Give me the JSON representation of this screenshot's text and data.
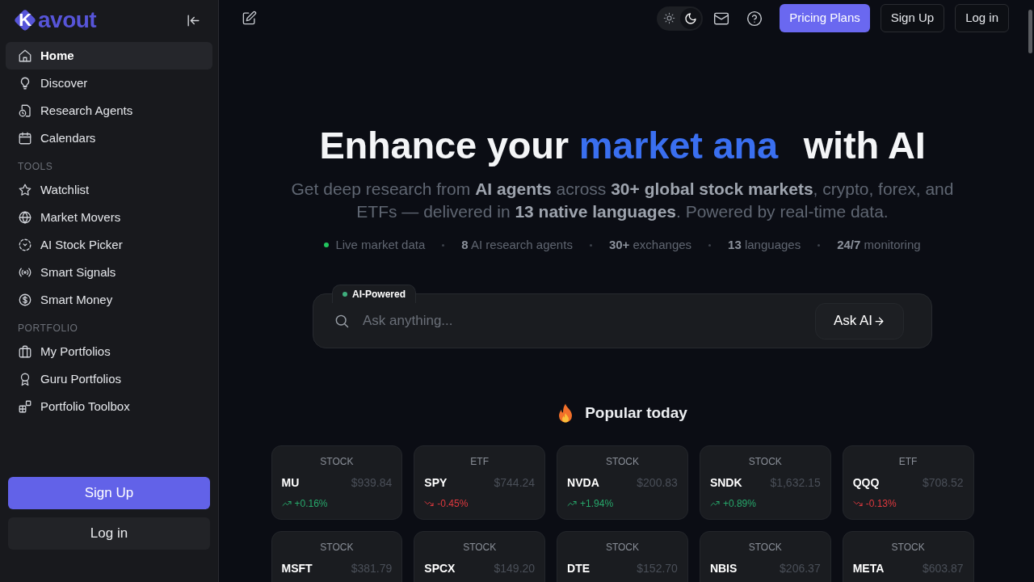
{
  "sidebar": {
    "logo": {
      "mark": "K",
      "text": "avout"
    },
    "sections": [
      {
        "items": [
          {
            "label": "Home",
            "selected": true
          },
          {
            "label": "Discover",
            "selected": false
          },
          {
            "label": "Research Agents",
            "selected": false
          },
          {
            "label": "Calendars",
            "selected": false
          }
        ]
      },
      {
        "title": "TOOLS",
        "items": [
          {
            "label": "Watchlist",
            "selected": false
          },
          {
            "label": "Market Movers",
            "selected": false
          },
          {
            "label": "AI Stock Picker",
            "selected": false
          },
          {
            "label": "Smart Signals",
            "selected": false
          },
          {
            "label": "Smart Money",
            "selected": false
          }
        ]
      },
      {
        "title": "PORTFOLIO",
        "items": [
          {
            "label": "My Portfolios",
            "selected": false
          },
          {
            "label": "Guru Portfolios",
            "selected": false
          },
          {
            "label": "Portfolio Toolbox",
            "selected": false
          }
        ]
      }
    ],
    "buttons": [
      {
        "label": "Sign Up",
        "kind": "primary"
      },
      {
        "label": "Log in",
        "kind": "secondary"
      }
    ]
  },
  "top_bar": {
    "theme_toggle": [
      {
        "kind": "light",
        "selected": false
      },
      {
        "kind": "dark",
        "selected": true
      }
    ],
    "buttons": [
      {
        "label": "Pricing Plans",
        "kind": "primary"
      },
      {
        "label": "Sign Up",
        "kind": "outline"
      },
      {
        "label": "Log in",
        "kind": "outline"
      }
    ]
  },
  "hero": {
    "heading": {
      "before": "Enhance your",
      "highlight": "market ana",
      "after": "with AI"
    },
    "subtitle": "Get deep research from **AI agents** across **30+ global stock markets**, crypto, forex, and ETFs — delivered in **13 native languages**. Powered by real-time data.",
    "stats": [
      {
        "kind": "live",
        "text": "Live market data"
      },
      {
        "kind": "stat",
        "text": "**8** AI research agents"
      },
      {
        "kind": "stat",
        "text": "**30+** exchanges"
      },
      {
        "kind": "stat",
        "text": "**13** languages"
      },
      {
        "kind": "stat",
        "text": "**24/7** monitoring"
      }
    ]
  },
  "search": {
    "badge": "AI-Powered",
    "placeholder": "Ask anything...",
    "button": "Ask AI"
  },
  "popular": {
    "title": "Popular today",
    "cards": [
      {
        "type": "STOCK",
        "ticker": "MU",
        "price": "$939.84",
        "change": "+0.16%",
        "rising": true
      },
      {
        "type": "ETF",
        "ticker": "SPY",
        "price": "$744.24",
        "change": "-0.45%",
        "rising": false
      },
      {
        "type": "STOCK",
        "ticker": "NVDA",
        "price": "$200.83",
        "change": "+1.94%",
        "rising": true
      },
      {
        "type": "STOCK",
        "ticker": "SNDK",
        "price": "$1,632.15",
        "change": "+0.89%",
        "rising": true
      },
      {
        "type": "ETF",
        "ticker": "QQQ",
        "price": "$708.52",
        "change": "-0.13%",
        "rising": false
      },
      {
        "type": "STOCK",
        "ticker": "MSFT",
        "price": "$381.79"
      },
      {
        "type": "STOCK",
        "ticker": "SPCX",
        "price": "$149.20"
      },
      {
        "type": "STOCK",
        "ticker": "DTE",
        "price": "$152.70"
      },
      {
        "type": "STOCK",
        "ticker": "NBIS",
        "price": "$206.37"
      },
      {
        "type": "STOCK",
        "ticker": "META",
        "price": "$603.87"
      }
    ]
  }
}
